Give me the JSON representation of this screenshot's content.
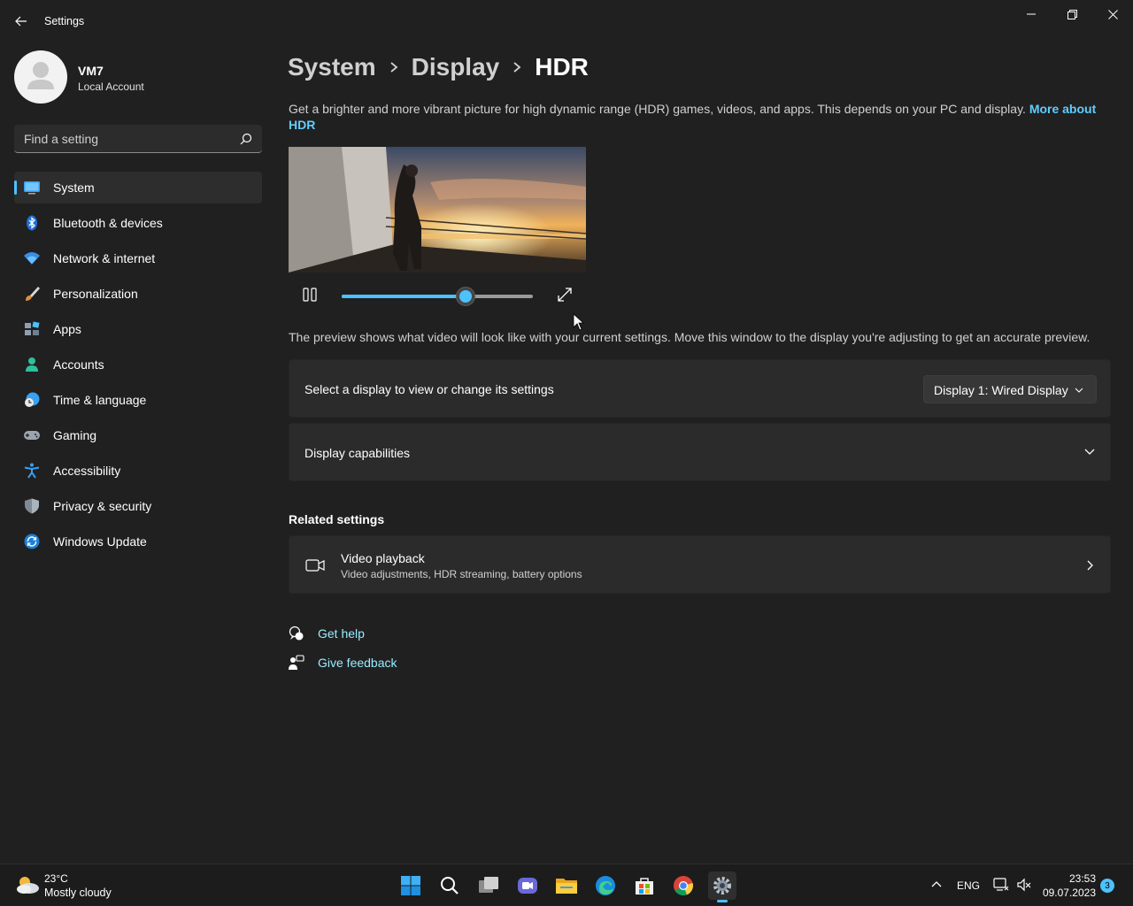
{
  "window": {
    "app_title": "Settings"
  },
  "profile": {
    "name": "VM7",
    "account_type": "Local Account"
  },
  "search": {
    "placeholder": "Find a setting"
  },
  "sidebar": {
    "items": [
      {
        "label": "System",
        "icon": "system-icon",
        "active": true
      },
      {
        "label": "Bluetooth & devices",
        "icon": "bluetooth-icon"
      },
      {
        "label": "Network & internet",
        "icon": "wifi-icon"
      },
      {
        "label": "Personalization",
        "icon": "paintbrush-icon"
      },
      {
        "label": "Apps",
        "icon": "apps-icon"
      },
      {
        "label": "Accounts",
        "icon": "person-icon"
      },
      {
        "label": "Time & language",
        "icon": "clock-globe-icon"
      },
      {
        "label": "Gaming",
        "icon": "gamepad-icon"
      },
      {
        "label": "Accessibility",
        "icon": "accessibility-icon"
      },
      {
        "label": "Privacy & security",
        "icon": "shield-icon"
      },
      {
        "label": "Windows Update",
        "icon": "update-icon"
      }
    ]
  },
  "breadcrumb": {
    "items": [
      "System",
      "Display",
      "HDR"
    ]
  },
  "main": {
    "description": "Get a brighter and more vibrant picture for high dynamic range (HDR) games, videos, and apps. This depends on your PC and display.",
    "more_link": "More about HDR",
    "player": {
      "progress": 0.65
    },
    "preview_note": "The preview shows what video will look like with your current settings. Move this window to the display you're adjusting to get an accurate preview.",
    "display_select": {
      "label": "Select a display to view or change its settings",
      "value": "Display 1: Wired Display"
    },
    "capabilities_label": "Display capabilities",
    "related_title": "Related settings",
    "video_playback": {
      "title": "Video playback",
      "subtitle": "Video adjustments, HDR streaming, battery options"
    },
    "get_help": "Get help",
    "give_feedback": "Give feedback"
  },
  "taskbar": {
    "weather_temp": "23°C",
    "weather_desc": "Mostly cloudy",
    "language": "ENG",
    "time": "23:53",
    "date": "09.07.2023",
    "notification_count": "3"
  },
  "colors": {
    "accent": "#4cc2ff",
    "link": "#60cdff",
    "background": "#202020",
    "card": "#2b2b2b"
  }
}
